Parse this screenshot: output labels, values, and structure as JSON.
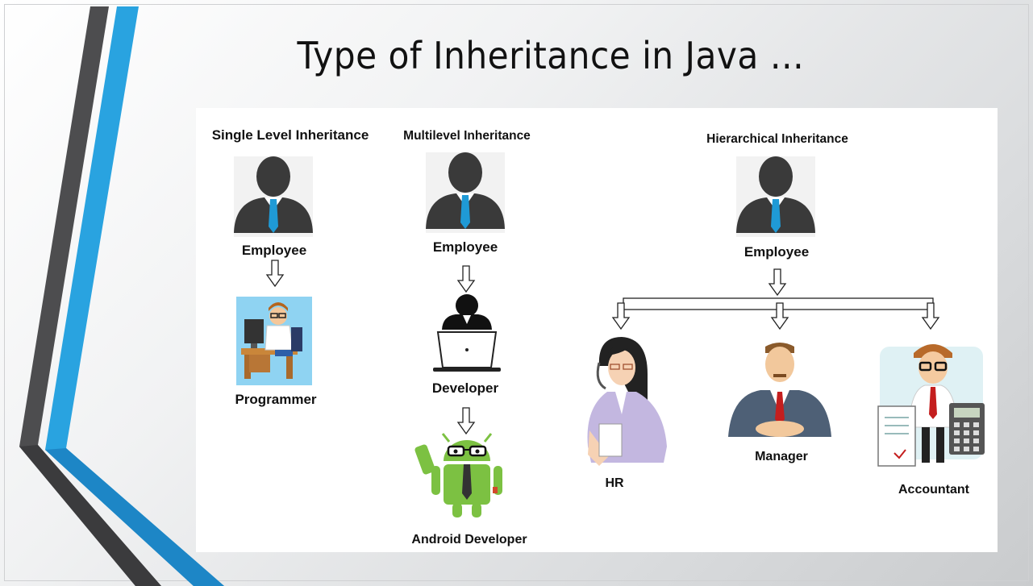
{
  "slide": {
    "title": "Type of Inheritance in Java …"
  },
  "sections": {
    "single": {
      "heading": "Single Level Inheritance",
      "parent": "Employee",
      "child": "Programmer"
    },
    "multilevel": {
      "heading": "Multilevel Inheritance",
      "level1": "Employee",
      "level2": "Developer",
      "level3": "Android Developer"
    },
    "hierarchical": {
      "heading": "Hierarchical Inheritance",
      "parent": "Employee",
      "children": [
        "HR",
        "Manager",
        "Accountant"
      ]
    }
  },
  "colors": {
    "accent_blue": "#29a3e0",
    "stripe_dark": "#4d4d4f",
    "silhouette": "#3a3a3a",
    "tie_blue": "#1f9ad6"
  },
  "icons": [
    "employee-silhouette-icon",
    "programmer-icon",
    "developer-laptop-icon",
    "android-developer-icon",
    "hr-woman-icon",
    "manager-icon",
    "accountant-icon"
  ]
}
